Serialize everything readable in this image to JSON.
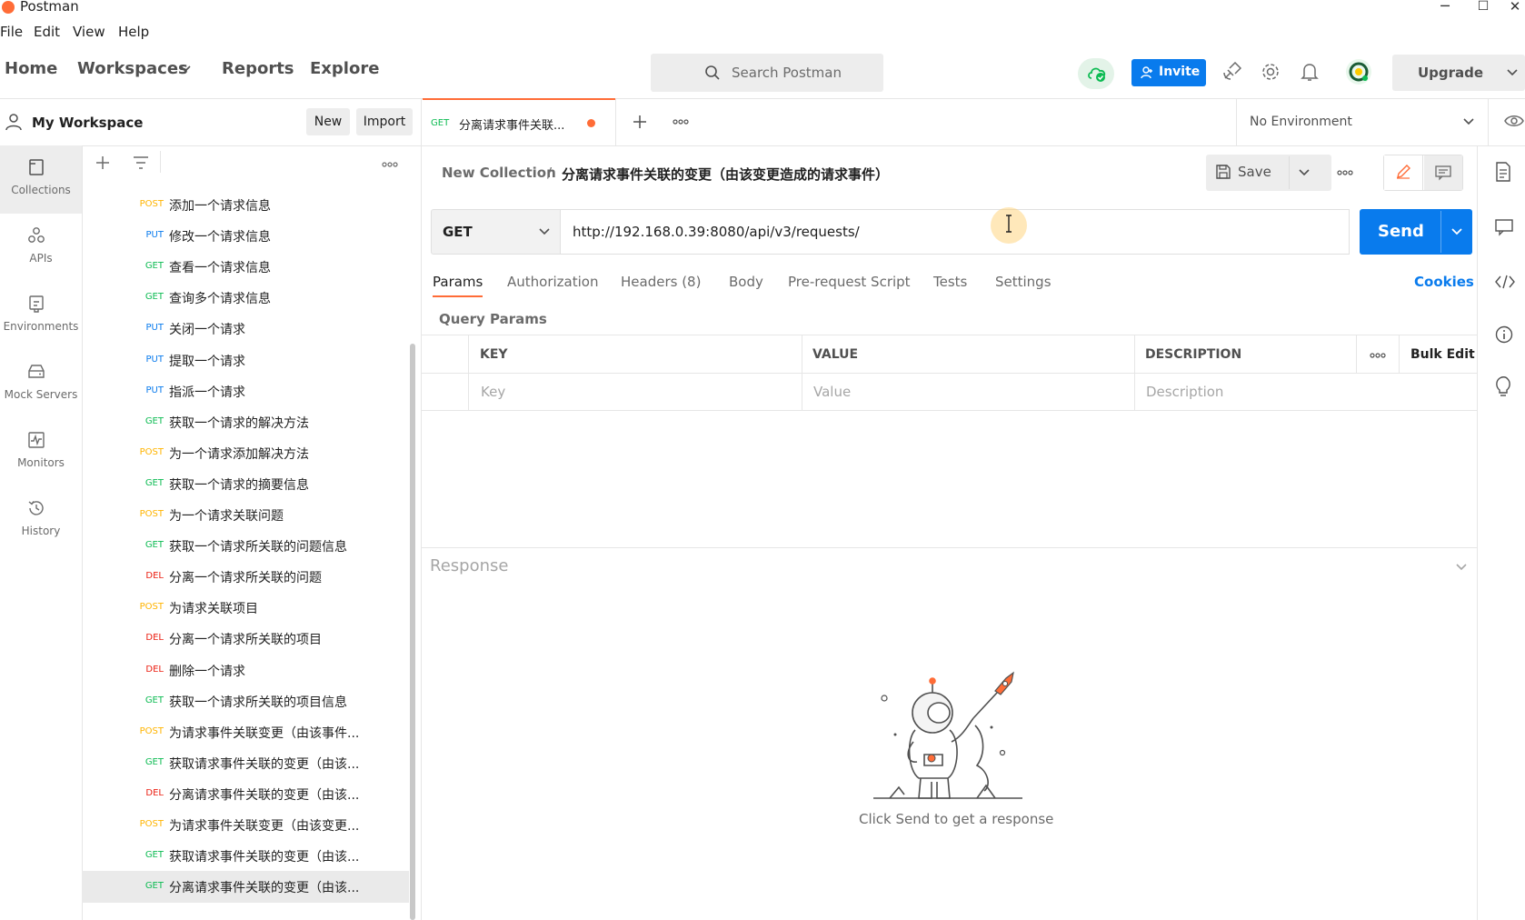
{
  "window": {
    "title": "Postman",
    "minimize": "─",
    "maximize": "☐",
    "close": "✕"
  },
  "menu": [
    "File",
    "Edit",
    "View",
    "Help"
  ],
  "nav": {
    "home": "Home",
    "workspaces": "Workspaces",
    "reports": "Reports",
    "explore": "Explore",
    "search_placeholder": "Search Postman",
    "invite": "Invite",
    "upgrade": "Upgrade"
  },
  "workspace": {
    "name": "My Workspace",
    "new": "New",
    "import": "Import"
  },
  "rail": [
    {
      "label": "Collections",
      "icon": "collections-icon"
    },
    {
      "label": "APIs",
      "icon": "apis-icon"
    },
    {
      "label": "Environments",
      "icon": "environments-icon"
    },
    {
      "label": "Mock Servers",
      "icon": "mock-servers-icon"
    },
    {
      "label": "Monitors",
      "icon": "monitors-icon"
    },
    {
      "label": "History",
      "icon": "history-icon"
    }
  ],
  "requests": [
    {
      "method": "POST",
      "name": "添加一个请求信息"
    },
    {
      "method": "PUT",
      "name": "修改一个请求信息"
    },
    {
      "method": "GET",
      "name": "查看一个请求信息"
    },
    {
      "method": "GET",
      "name": "查询多个请求信息"
    },
    {
      "method": "PUT",
      "name": "关闭一个请求"
    },
    {
      "method": "PUT",
      "name": "提取一个请求"
    },
    {
      "method": "PUT",
      "name": "指派一个请求"
    },
    {
      "method": "GET",
      "name": "获取一个请求的解决方法"
    },
    {
      "method": "POST",
      "name": "为一个请求添加解决方法"
    },
    {
      "method": "GET",
      "name": "获取一个请求的摘要信息"
    },
    {
      "method": "POST",
      "name": "为一个请求关联问题"
    },
    {
      "method": "GET",
      "name": "获取一个请求所关联的问题信息"
    },
    {
      "method": "DEL",
      "name": "分离一个请求所关联的问题"
    },
    {
      "method": "POST",
      "name": "为请求关联项目"
    },
    {
      "method": "DEL",
      "name": "分离一个请求所关联的项目"
    },
    {
      "method": "DEL",
      "name": "删除一个请求"
    },
    {
      "method": "GET",
      "name": "获取一个请求所关联的项目信息"
    },
    {
      "method": "POST",
      "name": "为请求事件关联变更（由该事件..."
    },
    {
      "method": "GET",
      "name": "获取请求事件关联的变更（由该..."
    },
    {
      "method": "DEL",
      "name": "分离请求事件关联的变更（由该..."
    },
    {
      "method": "POST",
      "name": "为请求事件关联变更（由该变更..."
    },
    {
      "method": "GET",
      "name": "获取请求事件关联的变更（由该..."
    },
    {
      "method": "GET",
      "name": "分离请求事件关联的变更（由该..."
    }
  ],
  "tab": {
    "method": "GET",
    "title": "分离请求事件关联...",
    "environment": "No Environment"
  },
  "breadcrumb": {
    "collection": "New Collection",
    "separator": "/",
    "request": "分离请求事件关联的变更（由该变更造成的请求事件）"
  },
  "toolbar": {
    "save": "Save"
  },
  "request": {
    "method": "GET",
    "url": "http://192.168.0.39:8080/api/v3/requests/",
    "send": "Send"
  },
  "request_tabs": [
    "Params",
    "Authorization",
    "Headers (8)",
    "Body",
    "Pre-request Script",
    "Tests",
    "Settings"
  ],
  "cookies": "Cookies",
  "query_params": {
    "title": "Query Params",
    "headers": {
      "key": "KEY",
      "value": "VALUE",
      "description": "DESCRIPTION",
      "bulk_edit": "Bulk Edit"
    },
    "placeholders": {
      "key": "Key",
      "value": "Value",
      "description": "Description"
    }
  },
  "response": {
    "title": "Response",
    "empty": "Click Send to get a response"
  },
  "colors": {
    "accent": "#ff6c37",
    "primary": "#097bed",
    "post": "#ffb400",
    "put": "#097bed",
    "get": "#0cbb52",
    "del": "#eb2013"
  }
}
